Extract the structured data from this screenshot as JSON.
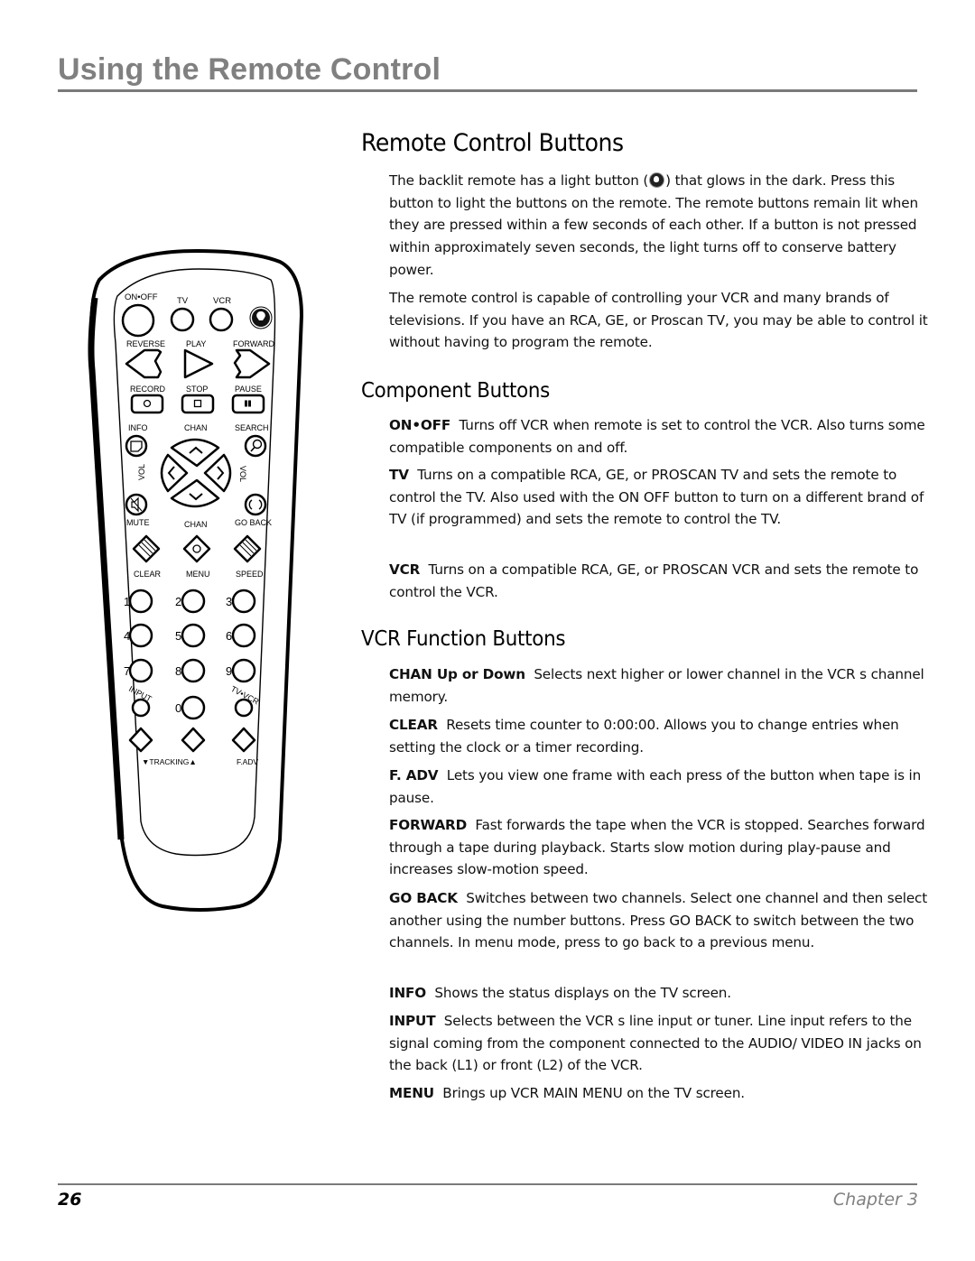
{
  "header": {
    "chapter_title": "Using the Remote Control"
  },
  "main": {
    "title": "Remote Control Buttons",
    "intro": [
      {
        "before": "The backlit remote has a light button (",
        "icon": "light-bulb-icon",
        "after": ") that glows in the dark. Press this button to light the buttons on the remote. The remote buttons remain lit when they are pressed within a few seconds of each other. If a button is not pressed within approximately seven seconds, the light turns off to conserve battery power."
      },
      {
        "text": "The remote control is capable of controlling your VCR and many brands of televisions. If you have an RCA, GE, or Proscan TV, you may be able to control it without having to program the remote."
      }
    ],
    "sections": [
      {
        "title": "Component Buttons",
        "items": [
          {
            "term": "ON•OFF",
            "desc": "Turns off VCR when remote is set to control the VCR. Also turns some compatible components on and off."
          },
          {
            "term": "TV",
            "desc": "Turns on a compatible RCA, GE, or PROSCAN TV and sets the remote to control the TV. Also used with the ON  OFF button to turn on a different brand of TV (if programmed) and sets the remote to control the TV."
          },
          {
            "term": "VCR",
            "desc": "Turns on a compatible RCA, GE, or PROSCAN VCR and sets the remote to control the VCR."
          }
        ]
      },
      {
        "title": "VCR Function Buttons",
        "items": [
          {
            "term": "CHAN Up or Down",
            "desc": " Selects next higher or lower channel in the VCR s channel memory."
          },
          {
            "term": "CLEAR",
            "desc": "Resets time counter to 0:00:00. Allows you to change entries when setting the clock or a timer recording."
          },
          {
            "term": "F. ADV",
            "desc": "Lets you view one frame with each press of the button when tape is in pause."
          },
          {
            "term": "FORWARD",
            "desc": "Fast forwards the tape when the VCR is stopped. Searches forward through a tape during playback. Starts slow motion during play-pause and increases slow-motion speed."
          },
          {
            "term": "GO BACK",
            "desc": "Switches between two channels. Select one channel and then select another using the number buttons. Press GO BACK to switch between the two channels. In menu mode, press to go back to a previous menu."
          },
          {
            "term": "INFO",
            "desc": "Shows the status displays on the TV screen."
          },
          {
            "term": "INPUT",
            "desc": "Selects between the VCR s line input or tuner. Line input refers to the signal coming from the component connected to the AUDIO/ VIDEO IN jacks on the back (L1) or front (L2) of the VCR."
          },
          {
            "term": "MENU",
            "desc": "Brings up VCR MAIN MENU on the TV screen."
          }
        ]
      }
    ]
  },
  "remote": {
    "labels": {
      "on_off": "ON•OFF",
      "tv": "TV",
      "vcr": "VCR",
      "reverse": "REVERSE",
      "play": "PLAY",
      "forward": "FORWARD",
      "record": "RECORD",
      "stop": "STOP",
      "pause": "PAUSE",
      "info": "INFO",
      "chan_up": "CHAN",
      "search": "SEARCH",
      "vol_left": "VOL",
      "vol_right": "VOL",
      "mute": "MUTE",
      "chan_down": "CHAN",
      "go_back": "GO BACK",
      "clear": "CLEAR",
      "menu": "MENU",
      "speed": "SPEED",
      "input": "INPUT",
      "tv_vcr": "TV•VCR",
      "tracking": "▼TRACKING▲",
      "fadv": "F.ADV"
    },
    "digits": [
      "1",
      "2",
      "3",
      "4",
      "5",
      "6",
      "7",
      "8",
      "9",
      "0"
    ]
  },
  "footer": {
    "page_number": "26",
    "chapter": "Chapter 3"
  }
}
